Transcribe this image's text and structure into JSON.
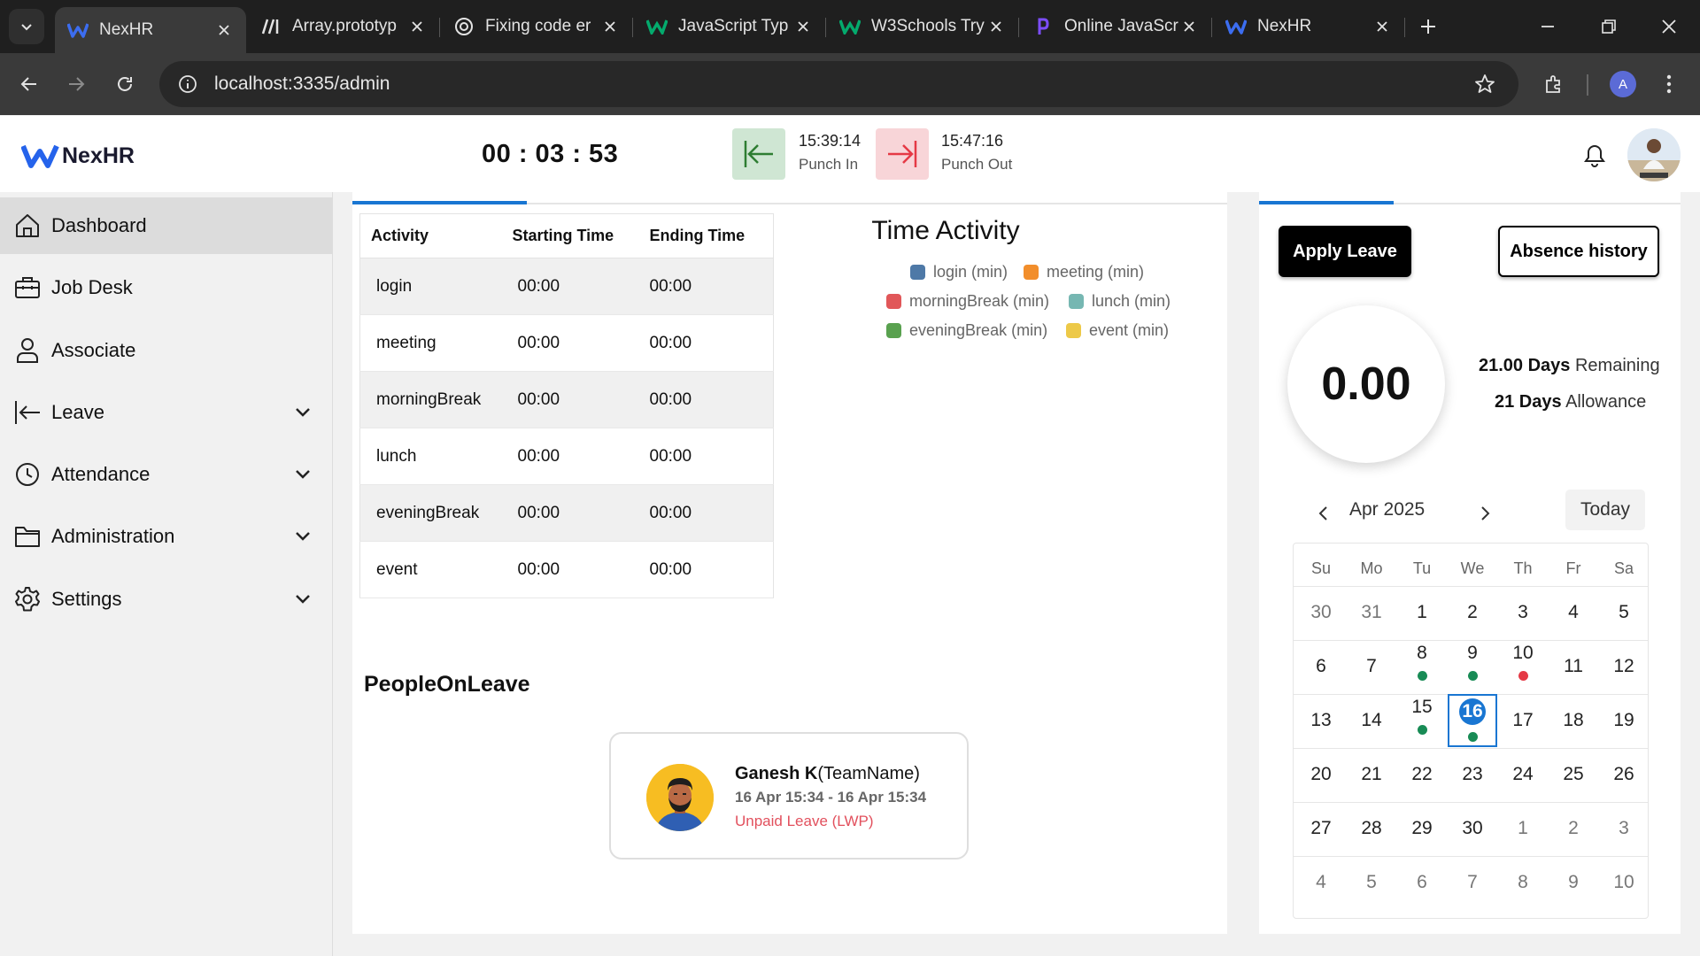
{
  "colors": {
    "accent": "#1976d2",
    "punch_in_bg": "#cfe6d3",
    "punch_in_icon": "#2e7d32",
    "punch_out_bg": "#f8d5d8",
    "punch_out_icon": "#e53945",
    "present_dot": "#188b55",
    "absent_dot": "#e53945",
    "leave_type": "#e2505d"
  },
  "browser": {
    "tabs": [
      {
        "title": "NexHR",
        "icon": "nexhr-icon",
        "active": true
      },
      {
        "title": "Array.prototyp",
        "icon": "mdn-icon",
        "active": false
      },
      {
        "title": "Fixing code er",
        "icon": "chatgpt-icon",
        "active": false
      },
      {
        "title": "JavaScript Typ",
        "icon": "w3schools-icon",
        "active": false
      },
      {
        "title": "W3Schools Try",
        "icon": "w3schools-icon",
        "active": false
      },
      {
        "title": "Online JavaScr",
        "icon": "programiz-icon",
        "active": false
      },
      {
        "title": "NexHR",
        "icon": "nexhr-icon",
        "active": false
      }
    ],
    "url": "localhost:3335/admin",
    "profile_initial": "A"
  },
  "header": {
    "brand": "NexHR",
    "timer": "00 : 03 : 53",
    "punch_in_time": "15:39:14",
    "punch_in_label": "Punch In",
    "punch_out_time": "15:47:16",
    "punch_out_label": "Punch Out"
  },
  "sidebar": {
    "items": [
      {
        "label": "Dashboard",
        "icon": "home-icon",
        "active": true,
        "expandable": false
      },
      {
        "label": "Job Desk",
        "icon": "briefcase-icon",
        "active": false,
        "expandable": false
      },
      {
        "label": "Associate",
        "icon": "person-icon",
        "active": false,
        "expandable": false
      },
      {
        "label": "Leave",
        "icon": "leave-arrow-icon",
        "active": false,
        "expandable": true
      },
      {
        "label": "Attendance",
        "icon": "clock-icon",
        "active": false,
        "expandable": true
      },
      {
        "label": "Administration",
        "icon": "folder-icon",
        "active": false,
        "expandable": true
      },
      {
        "label": "Settings",
        "icon": "gear-icon",
        "active": false,
        "expandable": true
      }
    ]
  },
  "activity_table": {
    "headers": [
      "Activity",
      "Starting Time",
      "Ending Time"
    ],
    "rows": [
      [
        "login",
        "00:00",
        "00:00"
      ],
      [
        "meeting",
        "00:00",
        "00:00"
      ],
      [
        "morningBreak",
        "00:00",
        "00:00"
      ],
      [
        "lunch",
        "00:00",
        "00:00"
      ],
      [
        "eveningBreak",
        "00:00",
        "00:00"
      ],
      [
        "event",
        "00:00",
        "00:00"
      ]
    ]
  },
  "time_activity": {
    "title": "Time Activity",
    "legend": [
      {
        "label": "login (min)",
        "color": "#4e79a7"
      },
      {
        "label": "meeting (min)",
        "color": "#f28e2b"
      },
      {
        "label": "morningBreak (min)",
        "color": "#e15759"
      },
      {
        "label": "lunch (min)",
        "color": "#76b7b2"
      },
      {
        "label": "eveningBreak (min)",
        "color": "#59a14f"
      },
      {
        "label": "event (min)",
        "color": "#edc948"
      }
    ]
  },
  "people_on_leave": {
    "title": "PeopleOnLeave",
    "card": {
      "name": "Ganesh K",
      "team": "(TeamName)",
      "dates": "16 Apr 15:34 - 16 Apr 15:34",
      "leave_type": "Unpaid Leave (LWP)"
    }
  },
  "leave_panel": {
    "apply_label": "Apply Leave",
    "absence_label": "Absence history",
    "balance": "0.00",
    "remaining_value": "21.00 Days",
    "remaining_label": "Remaining",
    "allowance_value": "21 Days",
    "allowance_label": "Allowance"
  },
  "calendar": {
    "month_label": "Apr 2025",
    "today_label": "Today",
    "weekdays": [
      "Su",
      "Mo",
      "Tu",
      "We",
      "Th",
      "Fr",
      "Sa"
    ],
    "weeks": [
      [
        {
          "d": "30",
          "o": true
        },
        {
          "d": "31",
          "o": true
        },
        {
          "d": "1"
        },
        {
          "d": "2"
        },
        {
          "d": "3"
        },
        {
          "d": "4"
        },
        {
          "d": "5"
        }
      ],
      [
        {
          "d": "6"
        },
        {
          "d": "7"
        },
        {
          "d": "8",
          "dot": "present"
        },
        {
          "d": "9",
          "dot": "present"
        },
        {
          "d": "10",
          "dot": "absent"
        },
        {
          "d": "11"
        },
        {
          "d": "12"
        }
      ],
      [
        {
          "d": "13"
        },
        {
          "d": "14"
        },
        {
          "d": "15",
          "dot": "present"
        },
        {
          "d": "16",
          "dot": "present",
          "today": true
        },
        {
          "d": "17"
        },
        {
          "d": "18"
        },
        {
          "d": "19"
        }
      ],
      [
        {
          "d": "20"
        },
        {
          "d": "21"
        },
        {
          "d": "22"
        },
        {
          "d": "23"
        },
        {
          "d": "24"
        },
        {
          "d": "25"
        },
        {
          "d": "26"
        }
      ],
      [
        {
          "d": "27"
        },
        {
          "d": "28"
        },
        {
          "d": "29"
        },
        {
          "d": "30"
        },
        {
          "d": "1",
          "o": true
        },
        {
          "d": "2",
          "o": true
        },
        {
          "d": "3",
          "o": true
        }
      ],
      [
        {
          "d": "4",
          "o": true
        },
        {
          "d": "5",
          "o": true
        },
        {
          "d": "6",
          "o": true
        },
        {
          "d": "7",
          "o": true
        },
        {
          "d": "8",
          "o": true
        },
        {
          "d": "9",
          "o": true
        },
        {
          "d": "10",
          "o": true
        }
      ]
    ]
  }
}
